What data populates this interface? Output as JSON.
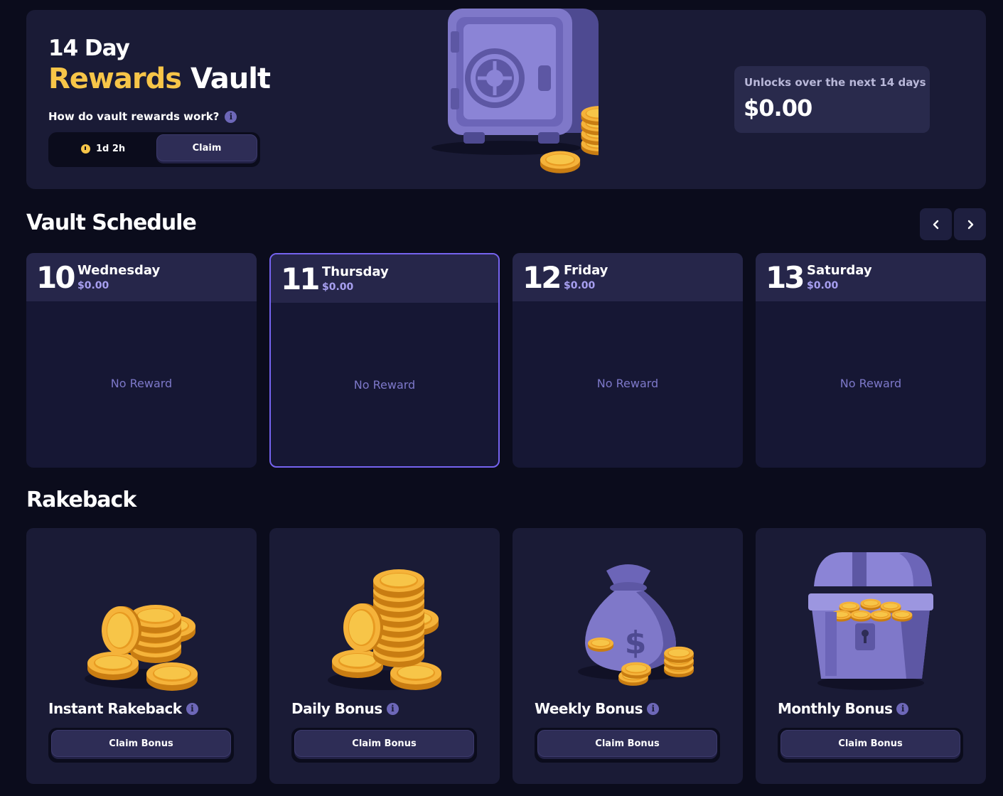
{
  "hero": {
    "pre_title": "14 Day",
    "title_highlight": "Rewards",
    "title_rest": "Vault",
    "how_text": "How do vault rewards work?",
    "timer": "1d 2h",
    "claim_label": "Claim",
    "unlock_label": "Unlocks over the next 14 days",
    "unlock_value": "$0.00"
  },
  "schedule": {
    "title": "Vault Schedule",
    "days": [
      {
        "num": "10",
        "name": "Wednesday",
        "amount": "$0.00",
        "status": "No Reward"
      },
      {
        "num": "11",
        "name": "Thursday",
        "amount": "$0.00",
        "status": "No Reward",
        "active": true
      },
      {
        "num": "12",
        "name": "Friday",
        "amount": "$0.00",
        "status": "No Reward"
      },
      {
        "num": "13",
        "name": "Saturday",
        "amount": "$0.00",
        "status": "No Reward"
      }
    ]
  },
  "rakeback": {
    "title": "Rakeback",
    "items": [
      {
        "title": "Instant Rakeback",
        "button": "Claim Bonus",
        "icon": "coins-pile-icon"
      },
      {
        "title": "Daily Bonus",
        "button": "Claim Bonus",
        "icon": "coin-stack-icon"
      },
      {
        "title": "Weekly Bonus",
        "button": "Claim Bonus",
        "icon": "money-bag-icon"
      },
      {
        "title": "Monthly Bonus",
        "button": "Claim Bonus",
        "icon": "treasure-chest-icon"
      }
    ]
  },
  "colors": {
    "background": "#0b0c1c",
    "card": "#1a1b36",
    "accent_gold": "#f7c548",
    "accent_purple": "#7563ef"
  }
}
